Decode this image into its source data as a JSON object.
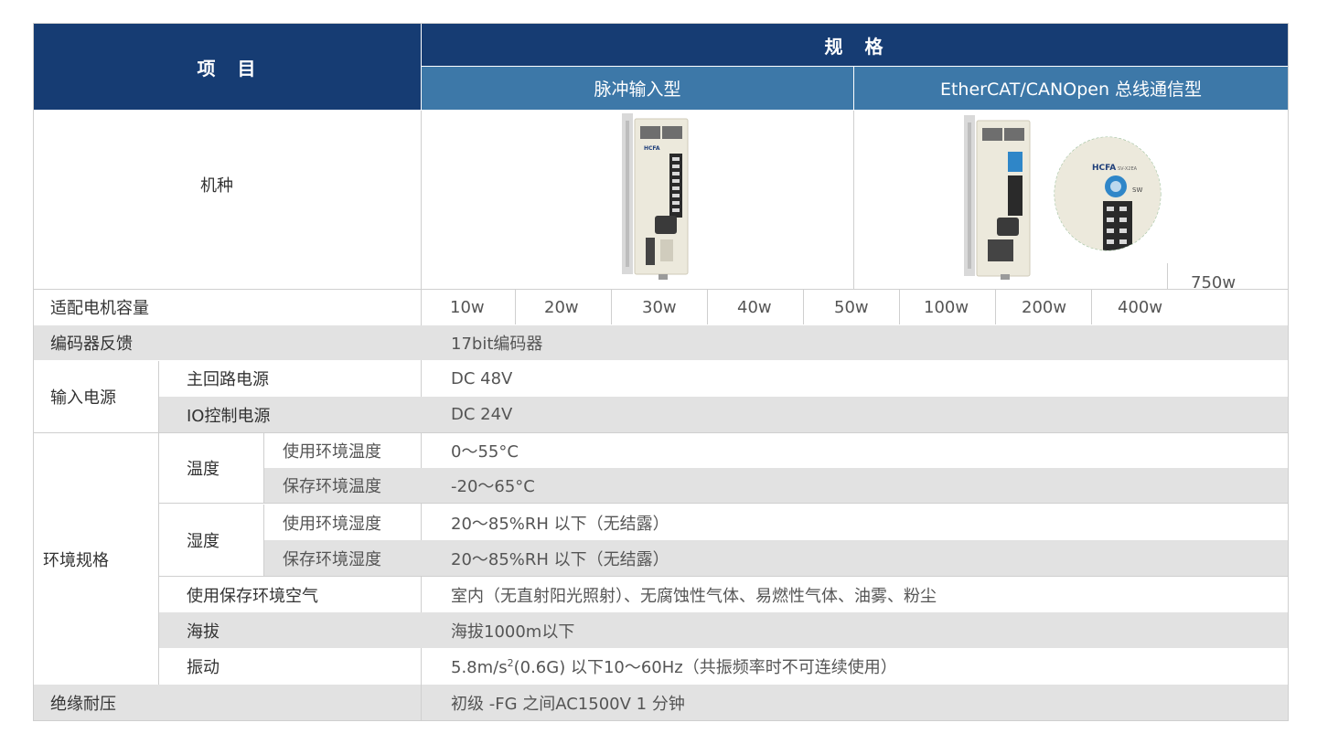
{
  "header": {
    "item": "项　目",
    "spec": "规　格",
    "pulse_type": "脉冲输入型",
    "bus_type": "EtherCAT/CANOpen 总线通信型"
  },
  "rows": {
    "model_label": "机种",
    "motor_capacity_label": "适配电机容量",
    "capacities": [
      "10w",
      "20w",
      "30w",
      "40w",
      "50w",
      "100w",
      "200w",
      "400w",
      "750w"
    ],
    "encoder_label": "编码器反馈",
    "encoder_value": "17bit编码器",
    "power_label": "输入电源",
    "main_power_label": "主回路电源",
    "main_power_value": "DC 48V",
    "io_power_label": "IO控制电源",
    "io_power_value": "DC 24V",
    "env_label": "环境规格",
    "temp_label": "温度",
    "temp_use_label": "使用环境温度",
    "temp_use_value": "0～55°C",
    "temp_store_label": "保存环境温度",
    "temp_store_value": "-20～65°C",
    "humid_label": "湿度",
    "humid_use_label": "使用环境湿度",
    "humid_use_value": "20～85%RH 以下（无结露）",
    "humid_store_label": "保存环境湿度",
    "humid_store_value": "20～85%RH 以下（无结露）",
    "air_label": "使用保存环境空气",
    "air_value": "室内（无直射阳光照射）、无腐蚀性气体、易燃性气体、油雾、粉尘",
    "altitude_label": "海拔",
    "altitude_value": "海拔1000m以下",
    "vibration_label": "振动",
    "vibration_value_pre": "5.8m/s",
    "vibration_value_sup": "2",
    "vibration_value_post": "(0.6G) 以下10～60Hz（共振频率时不可连续使用）",
    "insulation_label": "绝缘耐压",
    "insulation_value": "初级 -FG 之间AC1500V 1 分钟"
  },
  "device": {
    "brand": "HCFA",
    "model_text": "SV-X2EA",
    "dial_label": "SW"
  },
  "colors": {
    "header_dark": "#163c73",
    "header_mid": "#3d78a8",
    "row_gray": "#e2e2e2"
  }
}
